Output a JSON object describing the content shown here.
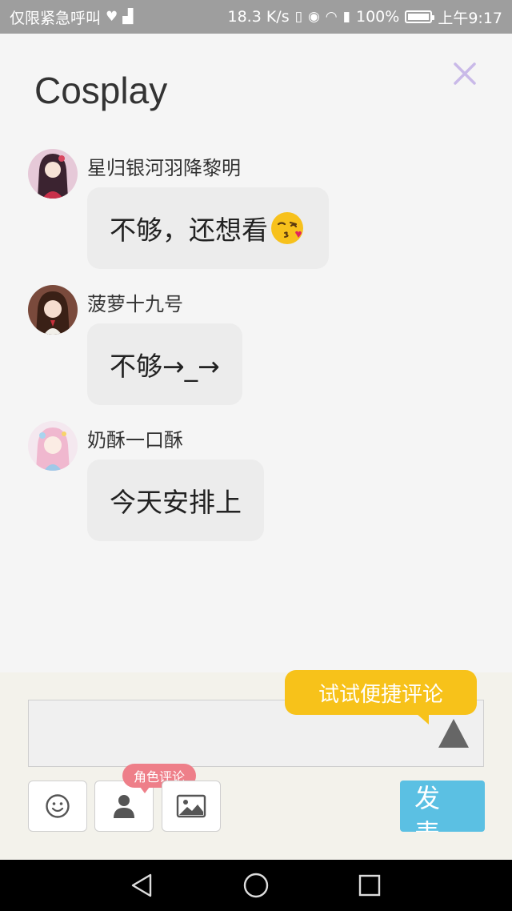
{
  "status_bar": {
    "left_text": "仅限紧急呼叫",
    "speed": "18.3 K/s",
    "battery": "100%",
    "time": "上午9:17",
    "battery_level": 1.0
  },
  "header": {
    "title": "Cosplay",
    "close_icon": "close-icon"
  },
  "comments": [
    {
      "username": "星归银河羽降黎明",
      "text": "不够，还想看",
      "emoji": "kissing-heart-emoji"
    },
    {
      "username": "菠萝十九号",
      "text": "不够→_→"
    },
    {
      "username": "奶酥一口酥",
      "text": "今天安排上"
    }
  ],
  "composer": {
    "tooltip": "试试便捷评论",
    "input_value": "",
    "role_tag": "角色评论",
    "send_label": "发表",
    "tools": [
      "smiley-icon",
      "person-icon",
      "image-icon"
    ],
    "colors": {
      "tooltip": "#f7c21a",
      "send": "#5bc0e3",
      "role_tag": "#ee7f89",
      "close": "#c9b9e8"
    }
  },
  "nav_bar": {
    "buttons": [
      "back-icon",
      "home-icon",
      "recents-icon"
    ]
  }
}
